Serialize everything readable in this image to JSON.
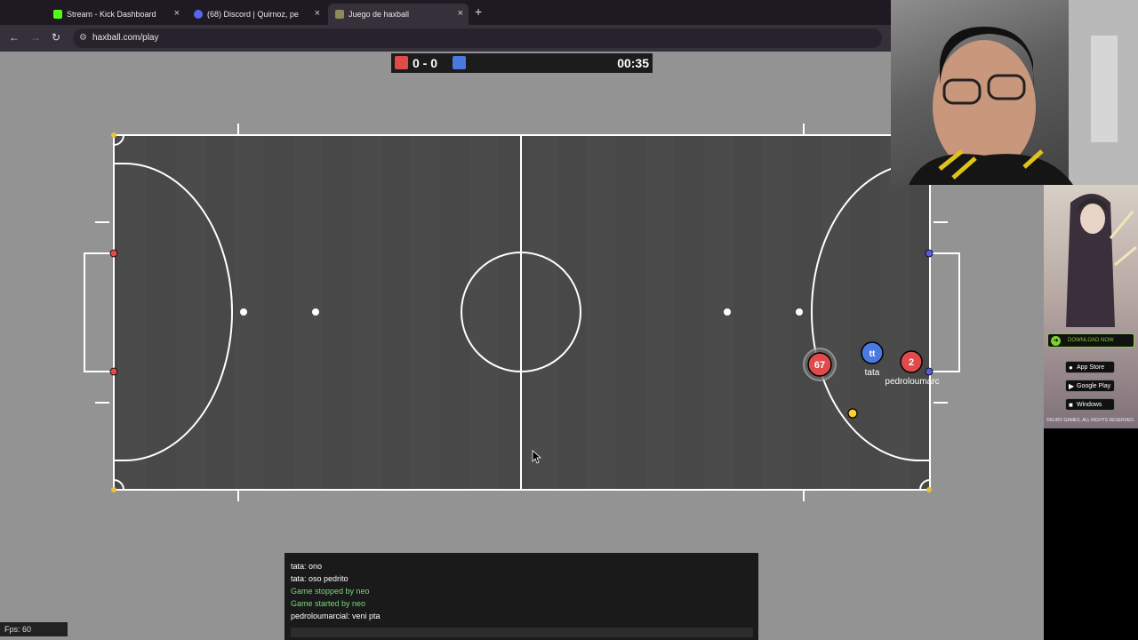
{
  "browser": {
    "tabs": [
      {
        "title": "Stream - Kick Dashboard",
        "favicon_color": "#53fc18",
        "favicon_glyph": "K"
      },
      {
        "title": "(68) Discord | Quirnoz, pe",
        "favicon_color": "#5865f2",
        "favicon_glyph": "D"
      },
      {
        "title": "Juego de haxball",
        "favicon_color": "#8f8a5a",
        "favicon_glyph": "H"
      }
    ],
    "new_tab": "+",
    "close_glyph": "×",
    "url": "haxball.com/play"
  },
  "scoreboard": {
    "red_color": "#e04a4a",
    "blue_color": "#4a7ae0",
    "score": "0 - 0",
    "timer": "00:35"
  },
  "field": {
    "players": [
      {
        "label": "67",
        "team": "red",
        "name": "",
        "kicking": true
      },
      {
        "label": "tt",
        "team": "blue",
        "name": "tata",
        "kicking": false
      },
      {
        "label": "2",
        "team": "red",
        "name": "pedroloumarc",
        "kicking": false
      }
    ],
    "ball_color": "#ffd02a"
  },
  "ad": {
    "download": "DOWNLOAD NOW",
    "stores": [
      "App Store",
      "Google Play",
      "Windows"
    ],
    "copyright": "©KURO GAMES. ALL RIGHTS RESERVED."
  },
  "chat": {
    "lines": [
      {
        "text": "tata: ono",
        "system": false
      },
      {
        "text": "tata: oso pedrito",
        "system": false
      },
      {
        "text": "Game stopped by neo",
        "system": true
      },
      {
        "text": "Game started by neo",
        "system": true
      },
      {
        "text": "pedroloumarcial: veni pta",
        "system": false
      }
    ]
  },
  "fps": "Fps: 60"
}
